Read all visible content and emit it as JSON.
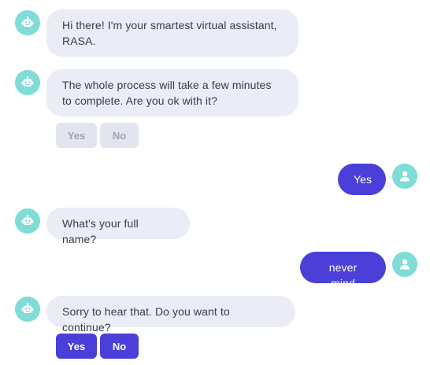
{
  "colors": {
    "bot_bubble": "#eaecf6",
    "user_bubble": "#4a3fd8",
    "avatar": "#7fdcd6",
    "button_disabled": "#e3e5ee",
    "button_active": "#4a3fd8"
  },
  "messages": [
    {
      "sender": "bot",
      "icon": "robot-icon",
      "text": "Hi there! I'm your smartest virtual assistant, RASA."
    },
    {
      "sender": "bot",
      "icon": "robot-icon",
      "text": "The whole process will take a few minutes to complete. Are you ok with it?"
    },
    {
      "sender": "user",
      "icon": "user-icon",
      "text": "Yes"
    },
    {
      "sender": "bot",
      "icon": "robot-icon",
      "text": "What's your full name?"
    },
    {
      "sender": "user",
      "icon": "user-icon",
      "text": "never mind"
    },
    {
      "sender": "bot",
      "icon": "robot-icon",
      "text": "Sorry to hear that. Do you want to continue?"
    }
  ],
  "quick_replies": [
    {
      "yes": "Yes",
      "no": "No",
      "state": "disabled"
    },
    {
      "yes": "Yes",
      "no": "No",
      "state": "active"
    }
  ]
}
